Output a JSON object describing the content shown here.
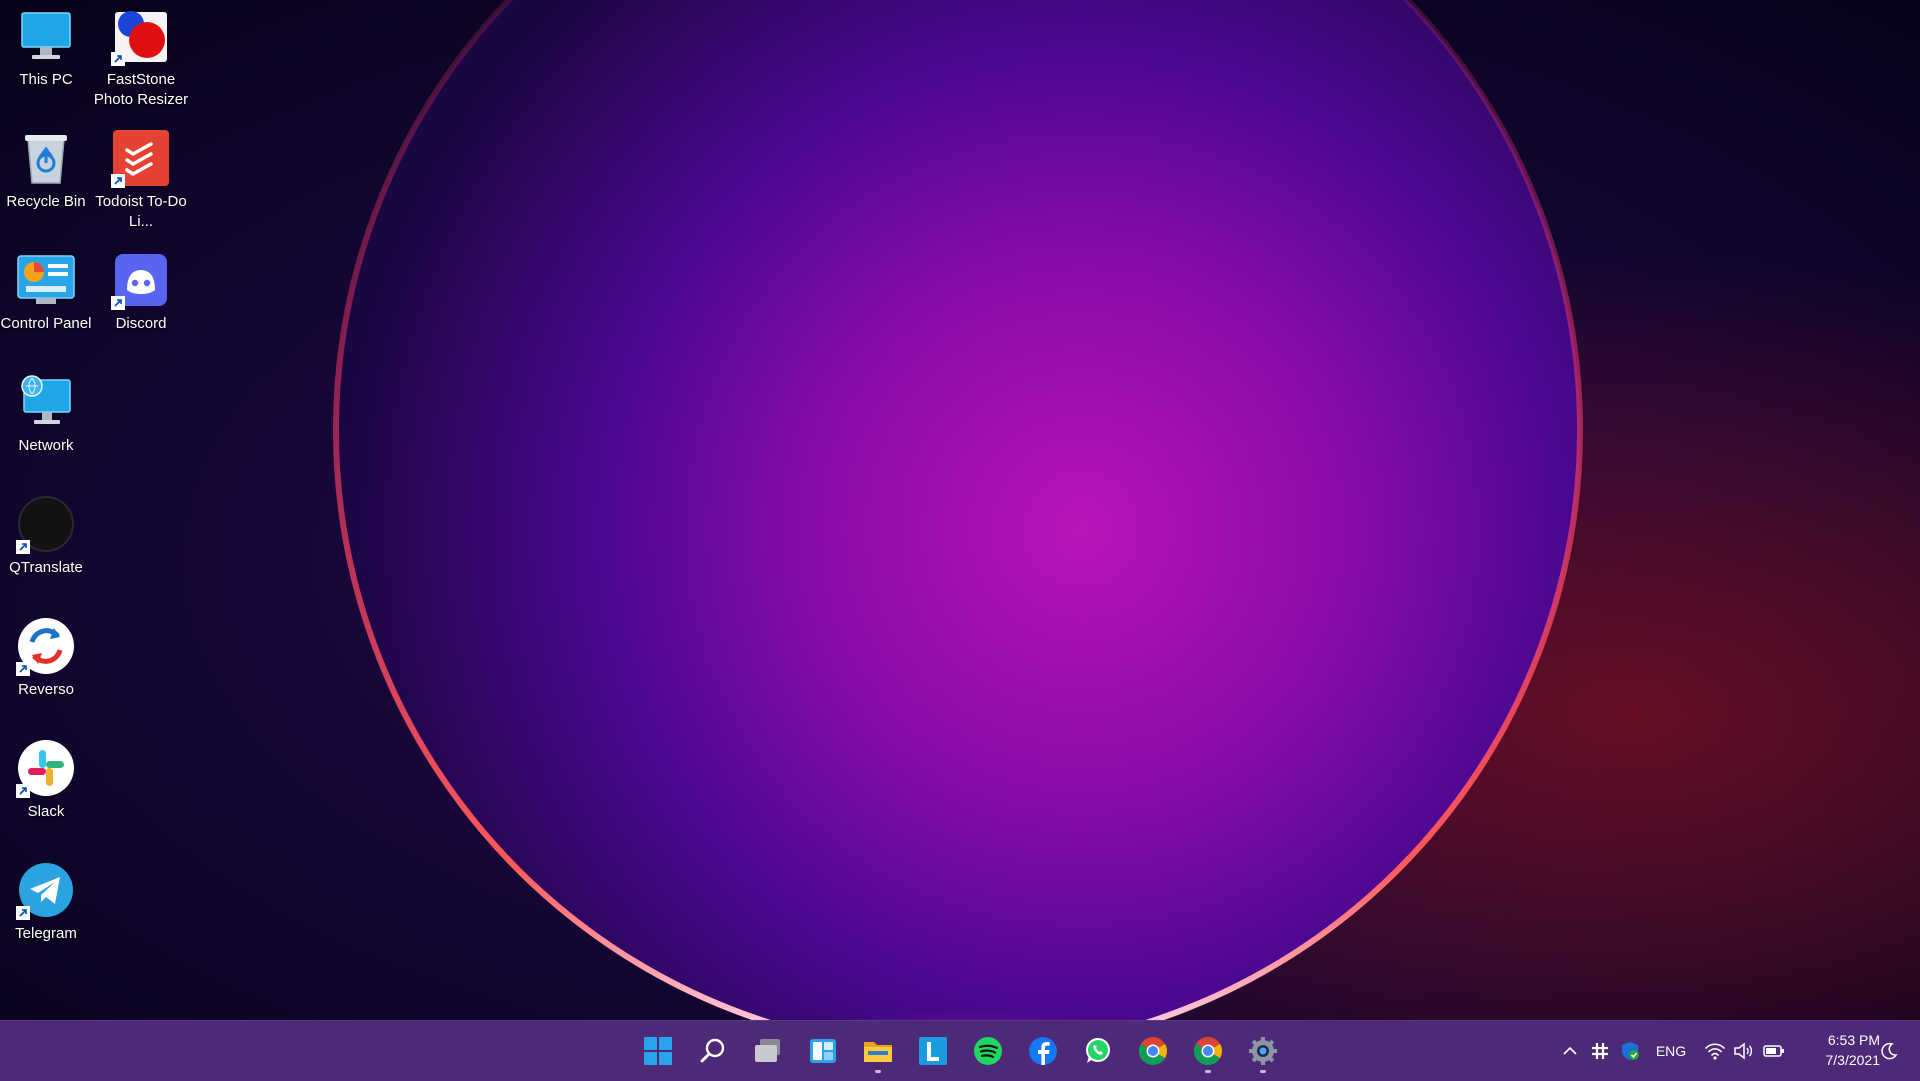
{
  "desktop": {
    "icons": [
      {
        "label": "This PC",
        "icon": "this-pc-icon",
        "shortcut": false
      },
      {
        "label": "FastStone Photo Resizer",
        "icon": "faststone-icon",
        "shortcut": true
      },
      {
        "label": "Recycle Bin",
        "icon": "recycle-bin-icon",
        "shortcut": false
      },
      {
        "label": "Todoist To-Do Li...",
        "icon": "todoist-icon",
        "shortcut": true
      },
      {
        "label": "Control Panel",
        "icon": "control-panel-icon",
        "shortcut": false
      },
      {
        "label": "Discord",
        "icon": "discord-icon",
        "shortcut": true
      },
      {
        "label": "Network",
        "icon": "network-icon",
        "shortcut": false
      },
      {
        "label": "QTranslate",
        "icon": "qtranslate-icon",
        "shortcut": true
      },
      {
        "label": "Reverso",
        "icon": "reverso-icon",
        "shortcut": true
      },
      {
        "label": "Slack",
        "icon": "slack-icon",
        "shortcut": true
      },
      {
        "label": "Telegram",
        "icon": "telegram-icon",
        "shortcut": true
      }
    ]
  },
  "taskbar": {
    "apps": [
      {
        "name": "start",
        "icon": "windows-start-icon",
        "running": false
      },
      {
        "name": "search",
        "icon": "search-icon",
        "running": false
      },
      {
        "name": "task-view",
        "icon": "task-view-icon",
        "running": false
      },
      {
        "name": "widgets",
        "icon": "widgets-icon",
        "running": false
      },
      {
        "name": "file-explorer",
        "icon": "folder-icon",
        "running": true
      },
      {
        "name": "l-app",
        "icon": "l-app-icon",
        "running": false
      },
      {
        "name": "spotify",
        "icon": "spotify-icon",
        "running": false
      },
      {
        "name": "facebook",
        "icon": "facebook-icon",
        "running": false
      },
      {
        "name": "whatsapp",
        "icon": "whatsapp-icon",
        "running": false
      },
      {
        "name": "chrome",
        "icon": "chrome-icon",
        "running": false
      },
      {
        "name": "chrome-2",
        "icon": "chrome-icon",
        "running": true
      },
      {
        "name": "settings",
        "icon": "gear-icon",
        "running": true
      }
    ],
    "tray": {
      "language": "ENG",
      "time": "6:53 PM",
      "date": "7/3/2021"
    },
    "colors": {
      "taskbar": "#4d2a78",
      "accent": "#0078d4"
    }
  }
}
